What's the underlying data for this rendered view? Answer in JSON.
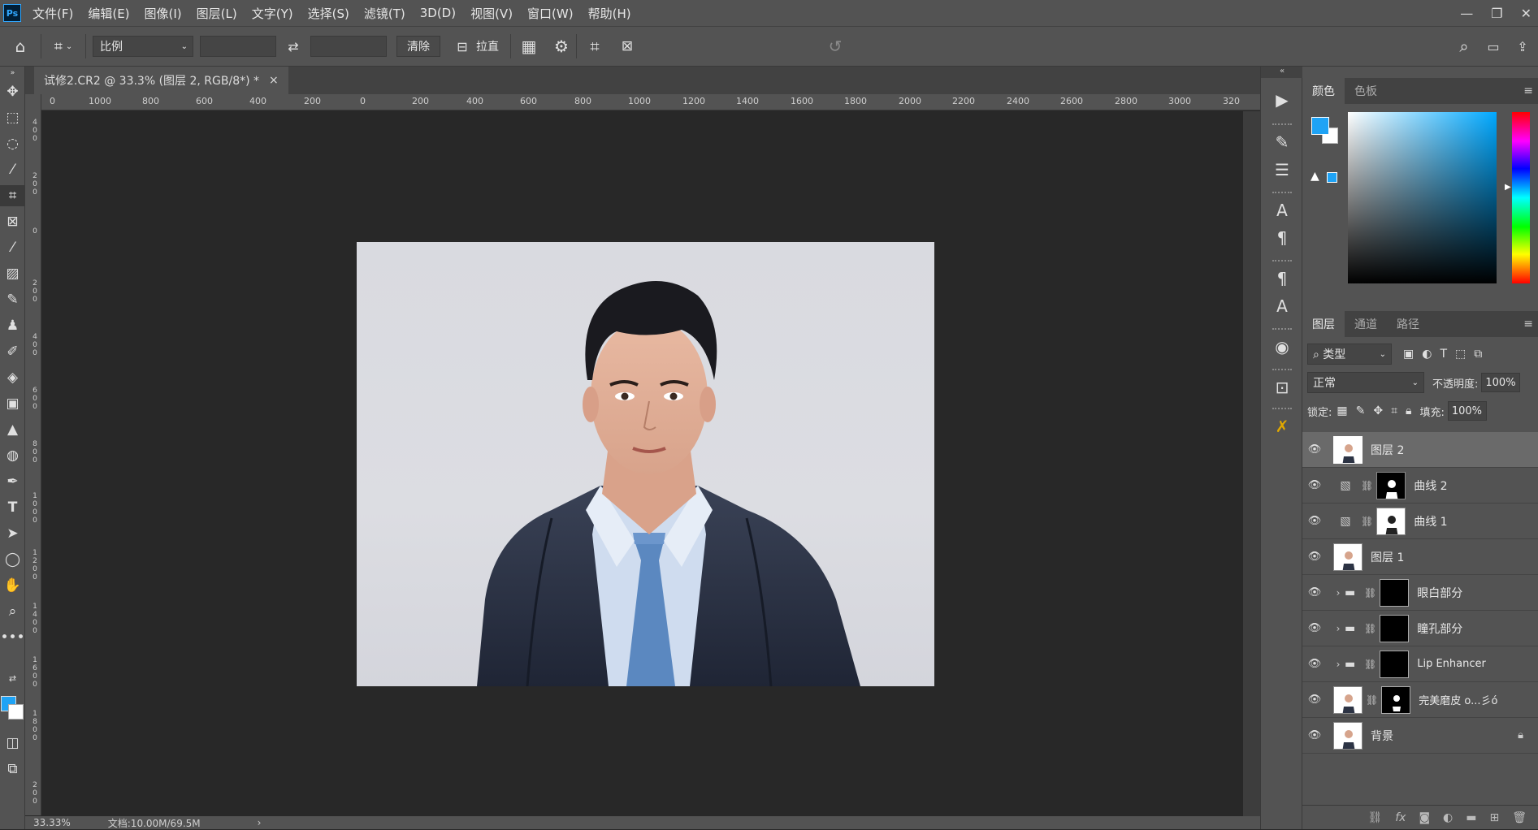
{
  "app": {
    "logo": "Ps",
    "menu": [
      "文件(F)",
      "编辑(E)",
      "图像(I)",
      "图层(L)",
      "文字(Y)",
      "选择(S)",
      "滤镜(T)",
      "3D(D)",
      "视图(V)",
      "窗口(W)",
      "帮助(H)"
    ]
  },
  "options_bar": {
    "ratio_select": "比例",
    "clear_button": "清除",
    "straighten_label": "拉直"
  },
  "document": {
    "tab_title": "试修2.CR2 @ 33.3% (图层 2, RGB/8*) *",
    "close_glyph": "×",
    "zoom": "33.33%",
    "file_info": "文档:10.00M/69.5M",
    "ruler_h_labels": [
      "0",
      "1000",
      "800",
      "600",
      "400",
      "200",
      "0",
      "200",
      "400",
      "600",
      "800",
      "1000",
      "1200",
      "1400",
      "1600",
      "1800",
      "2000",
      "2200",
      "2400",
      "2600",
      "2800",
      "3000",
      "320"
    ],
    "ruler_v_labels": [
      "400",
      "200",
      "0",
      "200",
      "400",
      "600",
      "800",
      "1000",
      "1200",
      "1400",
      "1600",
      "1800",
      "200"
    ]
  },
  "color_panel": {
    "tabs": [
      "颜色",
      "色板"
    ],
    "foreground": "#1fa3f5",
    "background": "#ffffff"
  },
  "layers_panel": {
    "tabs": [
      "图层",
      "通道",
      "路径"
    ],
    "filter_label": "类型",
    "blend_mode": "正常",
    "opacity_label": "不透明度:",
    "opacity_value": "100%",
    "lock_label": "锁定:",
    "fill_label": "填充:",
    "fill_value": "100%",
    "layers": [
      {
        "name": "图层 2",
        "kind": "pixel",
        "selected": true
      },
      {
        "name": "曲线 2",
        "kind": "adjustment"
      },
      {
        "name": "曲线 1",
        "kind": "adjustment"
      },
      {
        "name": "图层 1",
        "kind": "pixel"
      },
      {
        "name": "眼白部分",
        "kind": "group"
      },
      {
        "name": "瞳孔部分",
        "kind": "group"
      },
      {
        "name": "Lip Enhancer",
        "kind": "group"
      },
      {
        "name": "完美磨皮 o...彡ó",
        "kind": "smart"
      },
      {
        "name": "背景",
        "kind": "background",
        "locked": true
      }
    ]
  }
}
